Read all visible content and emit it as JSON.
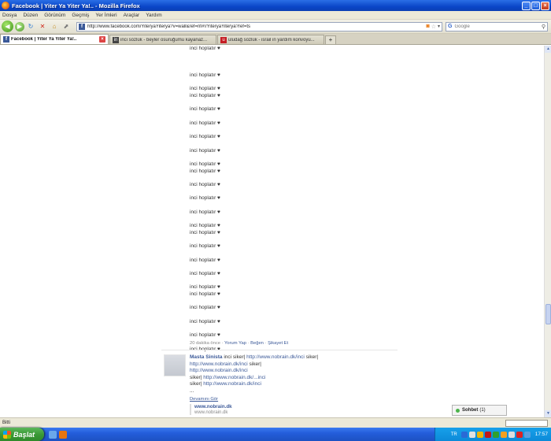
{
  "window": {
    "title": "Facebook | Yiter Ya Yiter Ya!.. - Mozilla Firefox",
    "controls": [
      "_",
      "□",
      "×"
    ]
  },
  "menu": [
    "Dosya",
    "Düzen",
    "Görünüm",
    "Geçmiş",
    "Yer İmleri",
    "Araçlar",
    "Yardım"
  ],
  "nav": {
    "url": "http://www.facebook.com/YiteryaYiterya?v=wall&ref=nf#!/YiteryaYiterya?ref=ts",
    "search_placeholder": "Google",
    "search_engine": "G"
  },
  "tabs": [
    {
      "label": "Facebook | Yiter Ya Yiter Ya!..",
      "icon": "f",
      "active": true
    },
    {
      "label": "inci sözlük - beyler osuruğumu kayanaz...",
      "icon": "in",
      "active": false
    },
    {
      "label": "uludağ sözlük - israil in yardım konvoyu...",
      "icon": "u",
      "active": false
    }
  ],
  "newtab_label": "+",
  "post": {
    "lines": [
      "inci hoplatır ♥",
      "inci hoplatır ♥",
      "inci hoplatır ♥",
      "inci hoplatır ♥",
      "inci hoplatır ♥",
      "inci hoplatır ♥",
      "inci hoplatır ♥",
      "inci hoplatır ♥",
      "inci hoplatır ♥",
      "inci hoplatır ♥",
      "inci hoplatır ♥",
      "inci hoplatır ♥",
      "inci hoplatır ♥",
      "inci hoplatır ♥",
      "inci hoplatır ♥",
      "inci hoplatır ♥",
      "inci hoplatır ♥",
      "inci hoplatır ♥",
      "inci hoplatır ♥",
      "inci hoplatır ♥",
      "inci hoplatır ♥",
      "inci hoplatır ♥",
      "inci hoplatır ♥",
      "inci hoplatır ♥"
    ],
    "meta_time": "20 dakika önce",
    "meta_sep": " · ",
    "actions": [
      "Yorum Yap",
      "Beğen",
      "Şikayet Et"
    ]
  },
  "comment": {
    "author": "Masta Sinista",
    "t1": "inci siker| ",
    "l1": "http://www.nobrain.dk/inci",
    "t2": " siker|",
    "l2": "http://www.nobrain.dk/inci",
    "t3": " siker|",
    "l3": "http://www.nobrain.dk/inci",
    "t4": "siker| ",
    "l4": "http://www.nobrain.dk/...inci",
    "t5": "siker| ",
    "l5": "http://www.nobrain.dk/inci",
    "ellipsis": "...",
    "more": "Devamını Gör",
    "link_title": "www.nobrain.dk",
    "link_url": "www.nobrain.dk"
  },
  "chat": {
    "label": "Sohbet",
    "count": "(1)"
  },
  "status": "Bitti",
  "taskbar": {
    "start": "Başlat",
    "lang": "TR",
    "clock": "17:57"
  }
}
